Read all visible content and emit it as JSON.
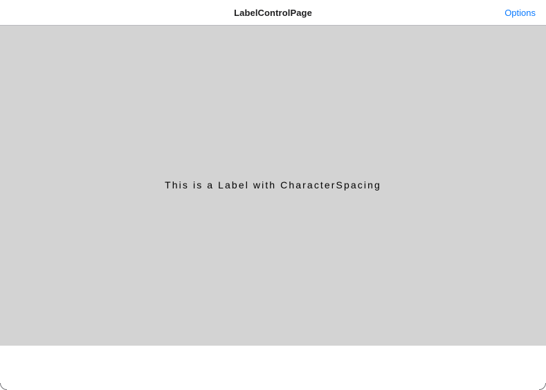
{
  "nav": {
    "title": "LabelControlPage",
    "options_label": "Options"
  },
  "content": {
    "label_text": "This is a Label with CharacterSpacing",
    "background_color": "#d3d3d3"
  },
  "colors": {
    "accent": "#0a7aff"
  }
}
